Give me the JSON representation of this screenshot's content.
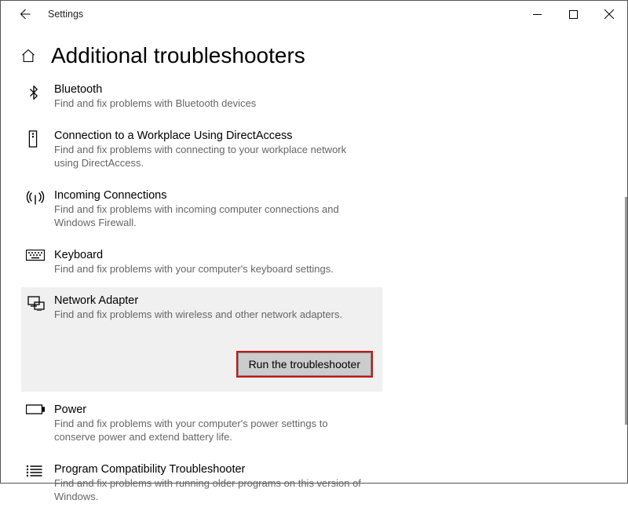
{
  "window": {
    "app_title": "Settings"
  },
  "page": {
    "title": "Additional troubleshooters"
  },
  "troubleshooters": [
    {
      "title": "Bluetooth",
      "desc": "Find and fix problems with Bluetooth devices"
    },
    {
      "title": "Connection to a Workplace Using DirectAccess",
      "desc": "Find and fix problems with connecting to your workplace network using DirectAccess."
    },
    {
      "title": "Incoming Connections",
      "desc": "Find and fix problems with incoming computer connections and Windows Firewall."
    },
    {
      "title": "Keyboard",
      "desc": "Find and fix problems with your computer's keyboard settings."
    },
    {
      "title": "Network Adapter",
      "desc": "Find and fix problems with wireless and other network adapters."
    },
    {
      "title": "Power",
      "desc": "Find and fix problems with your computer's power settings to conserve power and extend battery life."
    },
    {
      "title": "Program Compatibility Troubleshooter",
      "desc": "Find and fix problems with running older programs on this version of Windows."
    }
  ],
  "run_button": "Run the troubleshooter"
}
